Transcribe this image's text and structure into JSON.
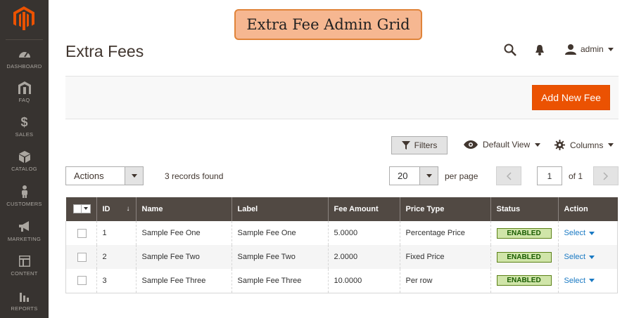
{
  "sidebar": {
    "items": [
      {
        "label": "DASHBOARD",
        "icon": "dashboard-icon"
      },
      {
        "label": "FAQ",
        "icon": "faq-icon"
      },
      {
        "label": "SALES",
        "icon": "dollar-icon"
      },
      {
        "label": "CATALOG",
        "icon": "box-icon"
      },
      {
        "label": "CUSTOMERS",
        "icon": "person-icon"
      },
      {
        "label": "MARKETING",
        "icon": "megaphone-icon"
      },
      {
        "label": "CONTENT",
        "icon": "layout-icon"
      },
      {
        "label": "REPORTS",
        "icon": "bar-chart-icon"
      }
    ]
  },
  "banner": {
    "text": "Extra Fee Admin Grid"
  },
  "header": {
    "title": "Extra Fees",
    "user": "admin"
  },
  "toolbar": {
    "add_label": "Add New Fee"
  },
  "controls": {
    "filters_label": "Filters",
    "view_label": "Default View",
    "columns_label": "Columns",
    "actions_label": "Actions",
    "records_found": "3 records found",
    "per_page_value": "20",
    "per_page_label": "per page",
    "page_value": "1",
    "page_of": "of 1"
  },
  "grid": {
    "columns": [
      "ID",
      "Name",
      "Label",
      "Fee Amount",
      "Price Type",
      "Status",
      "Action"
    ],
    "rows": [
      {
        "id": "1",
        "name": "Sample Fee One",
        "label": "Sample Fee One",
        "amount": "5.0000",
        "price_type": "Percentage Price",
        "status": "ENABLED",
        "action": "Select"
      },
      {
        "id": "2",
        "name": "Sample Fee Two",
        "label": "Sample Fee Two",
        "amount": "2.0000",
        "price_type": "Fixed Price",
        "status": "ENABLED",
        "action": "Select"
      },
      {
        "id": "3",
        "name": "Sample Fee Three",
        "label": "Sample Fee Three",
        "amount": "10.0000",
        "price_type": "Per row",
        "status": "ENABLED",
        "action": "Select"
      }
    ]
  },
  "colors": {
    "sidebar_bg": "#373330",
    "accent": "#eb5202",
    "header_bg": "#514943",
    "link": "#1979c3"
  }
}
